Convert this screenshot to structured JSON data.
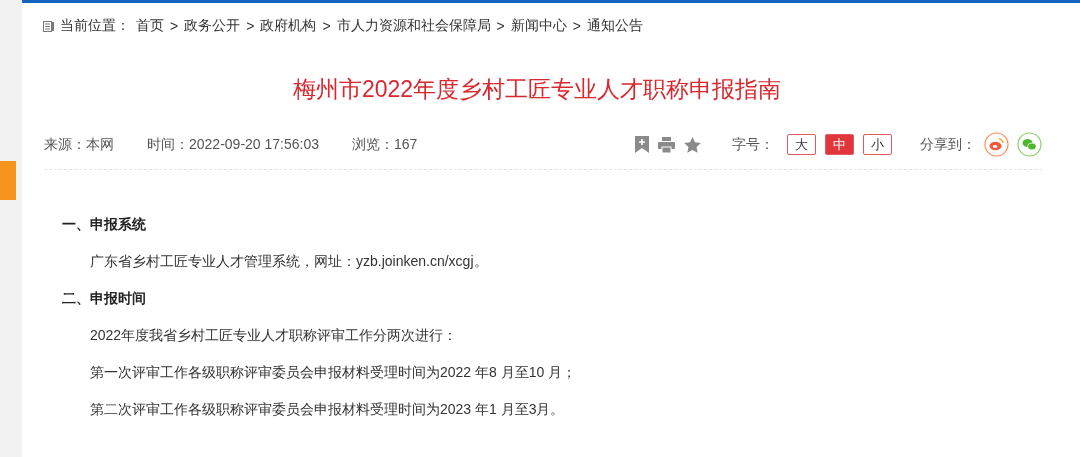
{
  "breadcrumb": {
    "label": "当前位置：",
    "separator": ">",
    "items": [
      "首页",
      "政务公开",
      "政府机构",
      "市人力资源和社会保障局",
      "新闻中心",
      "通知公告"
    ]
  },
  "article": {
    "title": "梅州市2022年度乡村工匠专业人才职称申报指南",
    "meta": [
      {
        "label": "来源：",
        "value": "本网"
      },
      {
        "label": "时间：",
        "value": "2022-09-20 17:56:03"
      },
      {
        "label": "浏览：",
        "value": "167"
      }
    ],
    "font_size": {
      "label": "字号：",
      "options": [
        {
          "label": "大",
          "selected": false
        },
        {
          "label": "中",
          "selected": true
        },
        {
          "label": "小",
          "selected": false
        }
      ]
    },
    "share": {
      "label": "分享到："
    },
    "sections": [
      {
        "heading": "一、申报系统",
        "paragraphs": [
          "广东省乡村工匠专业人才管理系统，网址：yzb.joinken.cn/xcgj。"
        ]
      },
      {
        "heading": "二、申报时间",
        "paragraphs": [
          "2022年度我省乡村工匠专业人才职称评审工作分两次进行：",
          "第一次评审工作各级职称评审委员会申报材料受理时间为2022 年8 月至10 月；",
          "第二次评审工作各级职称评审委员会申报材料受理时间为2023 年1 月至3月。"
        ]
      }
    ]
  }
}
